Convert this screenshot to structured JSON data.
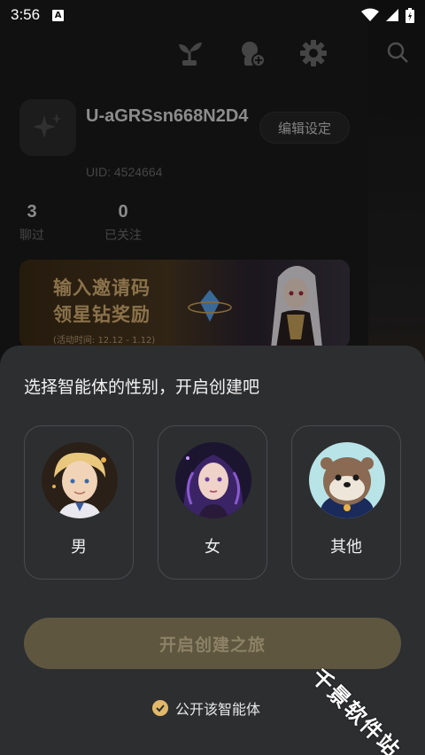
{
  "status_bar": {
    "time": "3:56",
    "notification_icon": "A"
  },
  "header": {
    "icons": [
      "sprout-icon",
      "add-character-icon",
      "gear-icon",
      "search-icon"
    ]
  },
  "profile": {
    "username": "U-aGRSsn668N2D4",
    "uid": "UID: 4524664",
    "edit_label": "编辑设定",
    "stats": [
      {
        "value": "3",
        "label": "聊过"
      },
      {
        "value": "0",
        "label": "已关注"
      }
    ]
  },
  "banner": {
    "line1": "输入邀请码",
    "line2": "领星钻奖励",
    "date": "(活动时间: 12.12 - 1.12)"
  },
  "sheet": {
    "title": "选择智能体的性别，开启创建吧",
    "options": [
      {
        "label": "男"
      },
      {
        "label": "女"
      },
      {
        "label": "其他"
      }
    ],
    "start_label": "开启创建之旅",
    "public_label": "公开该智能体"
  },
  "watermark": "千景软件站",
  "colors": {
    "sheet_bg": "#2d2e30",
    "button_bg": "#5e563f",
    "accent": "#e2b86a"
  }
}
